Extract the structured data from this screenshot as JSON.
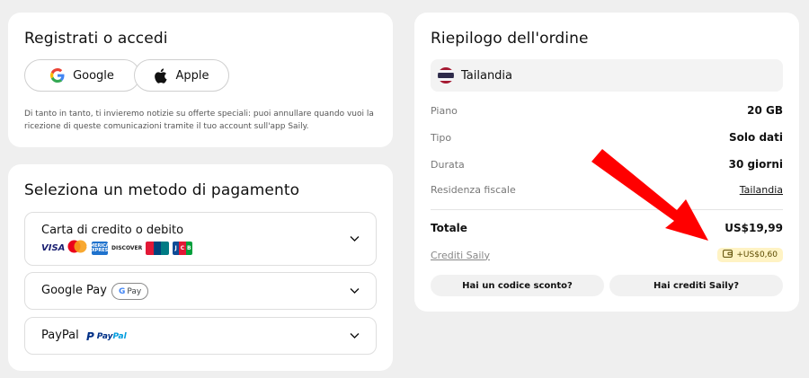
{
  "login": {
    "title": "Registrati o accedi",
    "google_label": "Google",
    "apple_label": "Apple",
    "disclaimer": "Di tanto in tanto, ti invieremo notizie su offerte speciali: puoi annullare quando vuoi la ricezione di queste comunicazioni tramite il tuo account sull'app Saily."
  },
  "payment": {
    "title": "Seleziona un metodo di pagamento",
    "options": [
      {
        "label": "Carta di credito o debito"
      },
      {
        "label": "Google Pay"
      },
      {
        "label": "PayPal"
      }
    ],
    "card_brands": {
      "visa": "VISA",
      "amex": "AMERICAN EXPRESS",
      "discover": "DISCOVER",
      "jcb": "JCB"
    },
    "gpay_badge": "Pay",
    "paypal_brand_a": "Pay",
    "paypal_brand_b": "Pal"
  },
  "summary": {
    "title": "Riepilogo dell'ordine",
    "country": "Tailandia",
    "rows": [
      {
        "key": "Piano",
        "value": "20 GB"
      },
      {
        "key": "Tipo",
        "value": "Solo dati"
      },
      {
        "key": "Durata",
        "value": "30 giorni"
      },
      {
        "key": "Residenza fiscale",
        "value": "Tailandia"
      }
    ],
    "total_label": "Totale",
    "total_value": "US$19,99",
    "credits_label": "Crediti Saily",
    "credits_value": "+US$0,60",
    "promo_button": "Hai un codice sconto?",
    "credits_button": "Hai crediti Saily?"
  },
  "colors": {
    "arrow": "#ff0000",
    "credit_badge_bg": "#fff3c4",
    "page_bg": "#efefef"
  }
}
